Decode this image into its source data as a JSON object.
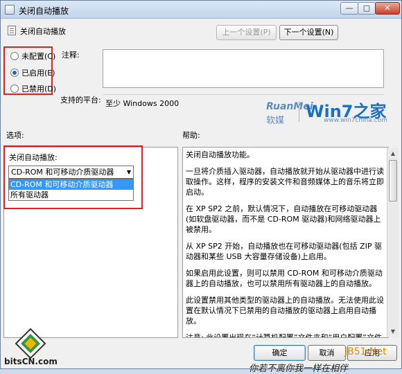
{
  "window": {
    "title": "关闭自动播放",
    "minimize": "—",
    "maximize": "□",
    "close": "✕"
  },
  "header": {
    "policy_name": "关闭自动播放",
    "prev_label": "上一个设置(P)",
    "next_label": "下一个设置(N)"
  },
  "state": {
    "not_configured": "未配置(C)",
    "enabled": "已启用(E)",
    "disabled": "已禁用(D)",
    "selected": "enabled"
  },
  "comment": {
    "label": "注释:",
    "value": ""
  },
  "platform": {
    "label": "支持的平台:",
    "value": "至少 Windows 2000"
  },
  "watermark": {
    "brand": "RuanMei",
    "brand_cn": "软媒",
    "site": "Win7之家",
    "url": "www.win7china.com"
  },
  "options": {
    "heading": "选项:",
    "dropdown_label": "关闭自动播放:",
    "selected": "CD-ROM 和可移动介质驱动器",
    "items": [
      "CD-ROM 和可移动介质驱动器",
      "所有驱动器"
    ]
  },
  "help": {
    "heading": "帮助:",
    "paragraphs": [
      "关闭自动播放功能。",
      "一旦将介质插入驱动器，自动播放就开始从驱动器中进行读取操作。这样，程序的安装文件和音频媒体上的音乐将立即启动。",
      "在 XP SP2 之前，默认情况下，自动播放在可移动驱动器(如软盘驱动器，而不是 CD-ROM 驱动器)和网络驱动器上被禁用。",
      "从 XP SP2 开始，自动播放也在可移动驱动器(包括 ZIP 驱动器和某些 USB 大容量存储设备)上启用。",
      "如果启用此设置，则可以禁用 CD-ROM 和可移动介质驱动器上的自动播放，也可以禁用所有驱动器上的自动播放。",
      "此设置禁用其他类型的驱动器上的自动播放。无法使用此设置在默认情况下已禁用的自动播放的驱动器上启用自动播放。",
      "注意: 此设置出现在“计算机配置”文件夹和“用户配置”文件夹中。如果两个设置发生冲突，则“计算机配置”中的设置优先于“"
    ]
  },
  "buttons": {
    "ok": "确定",
    "cancel": "取消",
    "apply": "应用"
  },
  "footer": {
    "site_name": "bitsCN.com",
    "jb51": "JB51.Net",
    "caption": "你若不离你我一样在相伴"
  },
  "colors": {
    "highlight": "#e0201c",
    "selection": "#3399ff",
    "accent": "#2a62c9"
  }
}
